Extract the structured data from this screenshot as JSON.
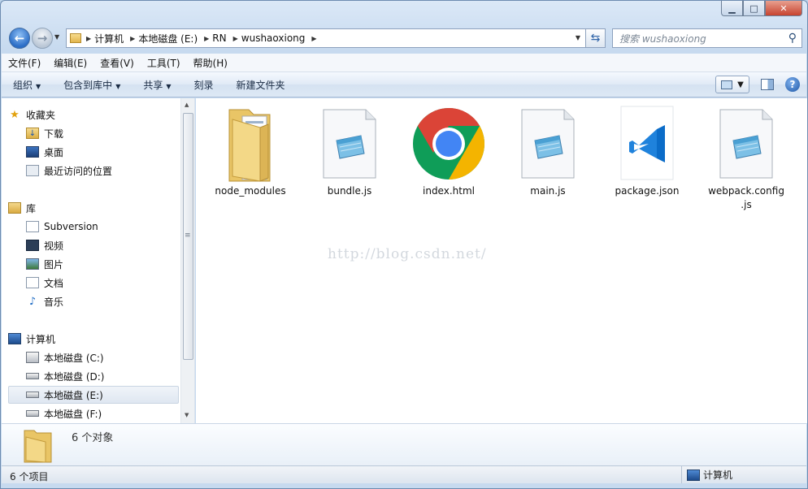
{
  "caption": {
    "minimize": "▁",
    "maximize": "□",
    "close": "✕"
  },
  "address": {
    "crumbs": [
      "计算机",
      "本地磁盘 (E:)",
      "RN",
      "wushaoxiong"
    ],
    "refresh_icon": "refresh-icon"
  },
  "search": {
    "placeholder": "搜索 wushaoxiong"
  },
  "menubar": {
    "file": "文件(F)",
    "edit": "编辑(E)",
    "view": "查看(V)",
    "tools": "工具(T)",
    "help": "帮助(H)"
  },
  "toolbar": {
    "organize": "组织",
    "include_in_library": "包含到库中",
    "share": "共享",
    "burn": "刻录",
    "new_folder": "新建文件夹"
  },
  "navpane": {
    "favorites": {
      "label": "收藏夹",
      "items": [
        "下载",
        "桌面",
        "最近访问的位置"
      ]
    },
    "libraries": {
      "label": "库",
      "items": [
        "Subversion",
        "视频",
        "图片",
        "文档",
        "音乐"
      ]
    },
    "computer": {
      "label": "计算机",
      "items": [
        "本地磁盘 (C:)",
        "本地磁盘 (D:)",
        "本地磁盘 (E:)",
        "本地磁盘 (F:)"
      ]
    },
    "selected": "本地磁盘 (E:)"
  },
  "files": [
    {
      "name": "node_modules",
      "kind": "folder"
    },
    {
      "name": "bundle.js",
      "kind": "notepad"
    },
    {
      "name": "index.html",
      "kind": "chrome"
    },
    {
      "name": "main.js",
      "kind": "notepad"
    },
    {
      "name": "package.json",
      "kind": "vscode"
    },
    {
      "name": "webpack.config\n.js",
      "kind": "notepad"
    }
  ],
  "watermark": "http://blog.csdn.net/",
  "details": {
    "count": "6 个对象"
  },
  "status": {
    "items": "6 个项目",
    "location": "计算机"
  },
  "colors": {
    "selection": "#dfe7f1",
    "window_frame": "#c7daef",
    "chrome_red": "#db4437",
    "chrome_green": "#0f9d58",
    "chrome_yellow": "#f4b400",
    "chrome_blue": "#4285f4",
    "vscode_blue": "#0b6cc8"
  }
}
